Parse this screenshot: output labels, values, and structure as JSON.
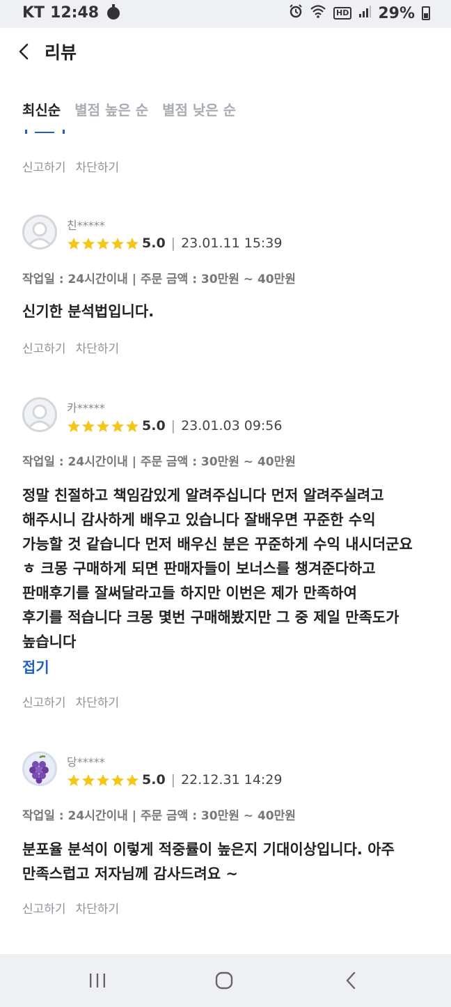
{
  "status_bar": {
    "carrier": "KT",
    "time": "12:48",
    "hd": "HD",
    "battery": "29%"
  },
  "header": {
    "title": "리뷰"
  },
  "sort_tabs": [
    {
      "label": "최신순",
      "active": true
    },
    {
      "label": "별점 높은 순",
      "active": false
    },
    {
      "label": "별점 낮은 순",
      "active": false
    }
  ],
  "actions": {
    "report": "신고하기",
    "block": "차단하기"
  },
  "reviews": [
    {
      "nickname": "친*****",
      "avatar": "default-avatar-icon",
      "score": "5.0",
      "date": "23.01.11 15:39",
      "meta": "작업일 : 24시간이내 | 주문 금액 : 30만원 ~ 40만원",
      "text": [
        "신기한 분석법입니다."
      ]
    },
    {
      "nickname": "카*****",
      "avatar": "default-avatar-icon",
      "score": "5.0",
      "date": "23.01.03 09:56",
      "meta": "작업일 : 24시간이내 | 주문 금액 : 30만원 ~ 40만원",
      "text": [
        "정말 친절하고 책임감있게 알려주십니다 먼저 알려주실려고",
        "해주시니 감사하게 배우고 있습니다 잘배우면 꾸준한 수익",
        "가능할 것 같습니다 먼저 배우신 분은 꾸준하게 수익 내시더군요",
        "ㅎ 크몽 구매하게 되면 판매자들이 보너스를 챙겨준다하고",
        "판매후기를 잘써달라고들 하지만 이번은 제가 만족하여",
        "후기를 적습니다 크몽  몇번 구매해봤지만 그 중 제일 만족도가",
        "높습니다"
      ],
      "fold_label": "접기"
    },
    {
      "nickname": "당*****",
      "avatar": "grape-avatar-icon",
      "score": "5.0",
      "date": "22.12.31 14:29",
      "meta": "작업일 : 24시간이내 | 주문 금액 : 30만원 ~ 40만원",
      "text": [
        "분포율 분석이 이렇게 적중률이 높은지 기대이상입니다. 아주",
        "만족스럽고 저자님께 감사드려요 ~"
      ]
    }
  ],
  "colors": {
    "star": "#f5c518",
    "link": "#1f5fbf",
    "muted": "#8d9298"
  }
}
